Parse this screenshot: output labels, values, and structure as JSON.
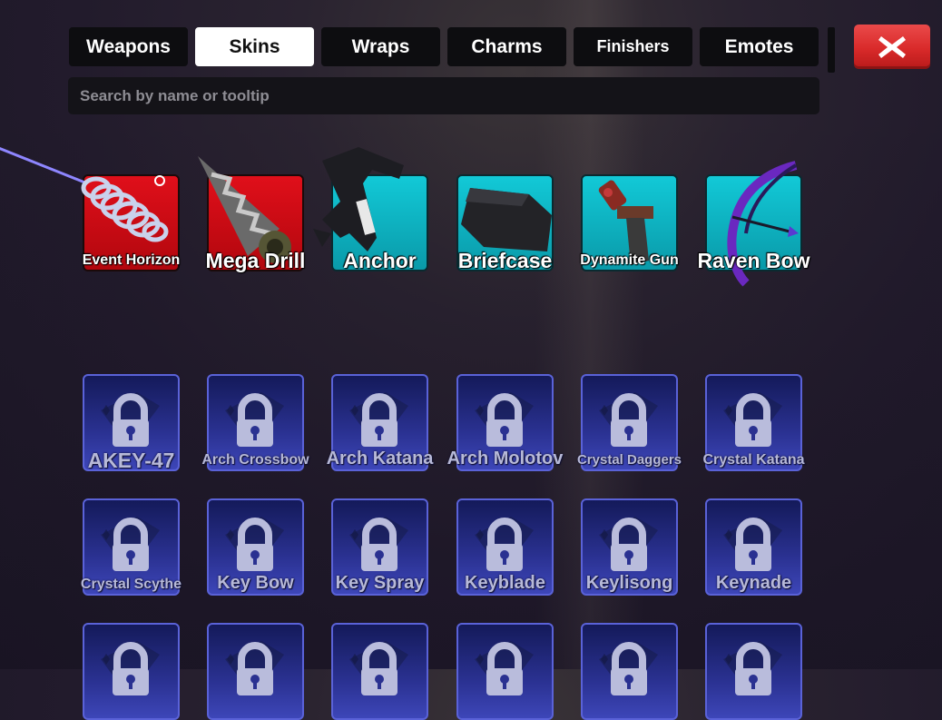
{
  "tabs": [
    {
      "label": "Weapons",
      "active": false
    },
    {
      "label": "Skins",
      "active": true
    },
    {
      "label": "Wraps",
      "active": false
    },
    {
      "label": "Charms",
      "active": false
    },
    {
      "label": "Finishers",
      "active": false
    },
    {
      "label": "Emotes",
      "active": false
    }
  ],
  "search": {
    "placeholder": "Search by name or tooltip",
    "value": ""
  },
  "close_button": {
    "icon": "close-x-icon",
    "color": "#e03a3a"
  },
  "owned_skins": [
    {
      "name": "Event Horizon",
      "rarity_color": "#e00f1a"
    },
    {
      "name": "Mega Drill",
      "rarity_color": "#e00f1a"
    },
    {
      "name": "Anchor",
      "rarity_color": "#12c9d7"
    },
    {
      "name": "Briefcase",
      "rarity_color": "#12c9d7"
    },
    {
      "name": "Dynamite Gun",
      "rarity_color": "#12c9d7"
    },
    {
      "name": "Raven Bow",
      "rarity_color": "#12c9d7"
    }
  ],
  "locked_skins": [
    {
      "name": "AKEY-47"
    },
    {
      "name": "Arch Crossbow"
    },
    {
      "name": "Arch Katana"
    },
    {
      "name": "Arch Molotov"
    },
    {
      "name": "Crystal Daggers"
    },
    {
      "name": "Crystal Katana"
    },
    {
      "name": "Crystal Scythe"
    },
    {
      "name": "Key Bow"
    },
    {
      "name": "Key Spray"
    },
    {
      "name": "Keyblade"
    },
    {
      "name": "Keylisong"
    },
    {
      "name": "Keynade"
    }
  ]
}
